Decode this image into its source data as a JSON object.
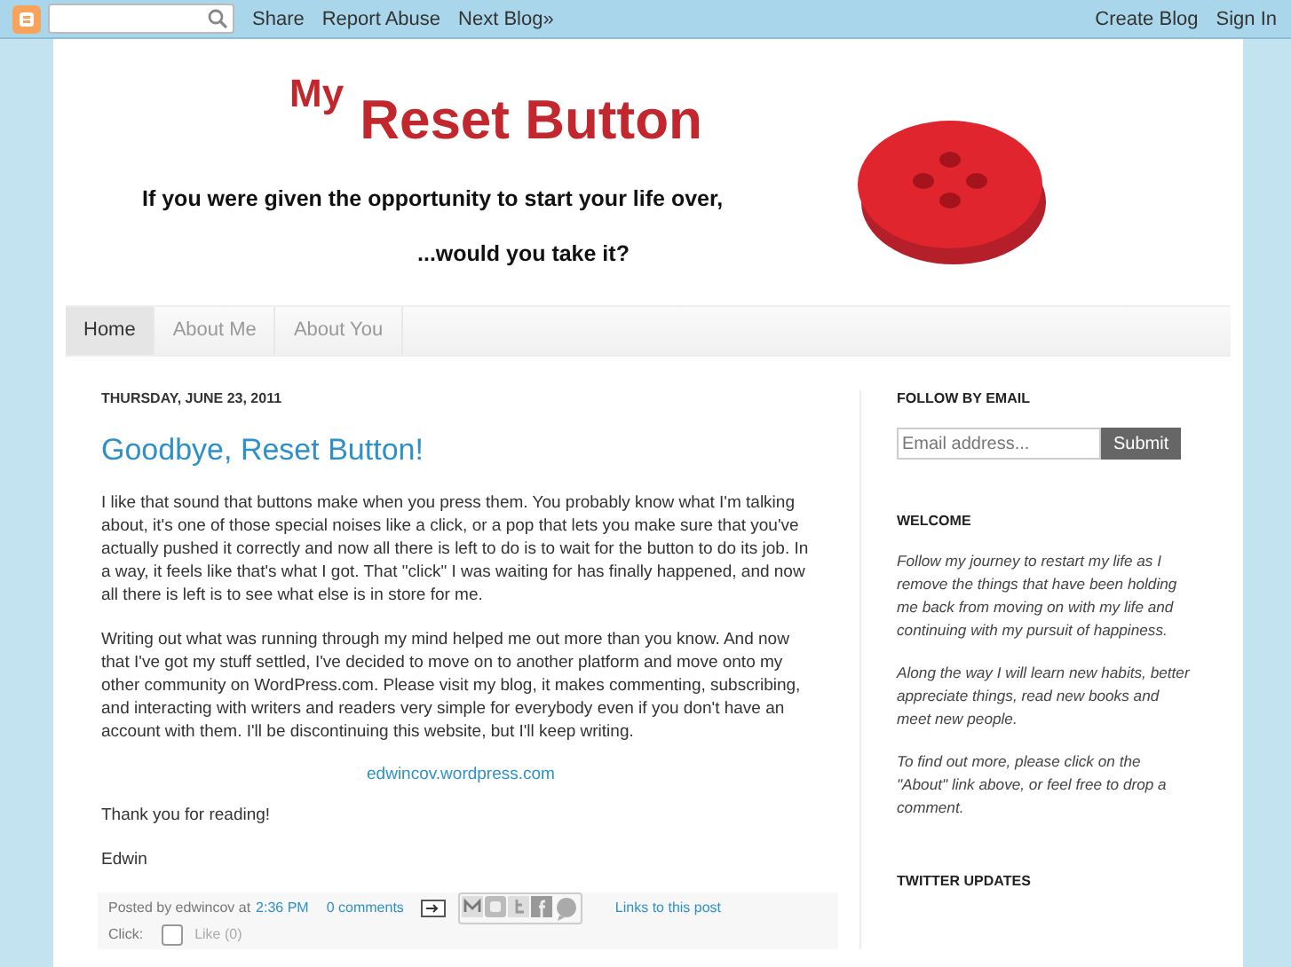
{
  "navbar": {
    "left_links": [
      "Share",
      "Report Abuse",
      "Next Blog»"
    ],
    "right_links": [
      "Create Blog",
      "Sign In"
    ]
  },
  "header": {
    "title_small": "My",
    "title_large": "Reset Button",
    "tagline_1": "If you were given the opportunity to start your life over,",
    "tagline_2": "...would you take it?"
  },
  "tabs": [
    {
      "label": "Home",
      "selected": true
    },
    {
      "label": "About Me",
      "selected": false
    },
    {
      "label": "About You",
      "selected": false
    }
  ],
  "post": {
    "date": "THURSDAY, JUNE 23, 2011",
    "title": "Goodbye, Reset Button!",
    "paragraphs": [
      "I like that sound that buttons make when you press them. You probably know what I'm talking about, it's one of those special noises like a click, or a pop that lets you make sure that you've actually pushed it correctly and now all there is left to do is to wait for the button to do its job. In a way, it feels like that's what I got. That \"click\" I was waiting for has finally happened, and now all there is left is to see what else is in store for me.",
      "Writing out what  was running through my mind helped me out more than you know. And now that I've got my stuff settled, I've decided to move on to another platform and move onto my other community on WordPress.com. Please visit my blog, it makes commenting, subscribing, and interacting with writers and readers very simple for everybody even if you don't have an account with them. I'll be discontinuing this website, but I'll keep writing."
    ],
    "link": "edwincov.wordpress.com",
    "closing": "Thank you for reading!",
    "signature": "Edwin",
    "footer": {
      "posted_by": "Posted by edwincov at",
      "time": "2:36 PM",
      "comments": "0 comments",
      "links": "Links to this post",
      "click_label": "Click:",
      "like": {
        "label": "Like (0)",
        "checked": false
      }
    }
  },
  "sidebar": {
    "follow_title": "FOLLOW BY EMAIL",
    "email_placeholder": "Email address...",
    "submit": "Submit",
    "welcome_title": "WELCOME",
    "welcome_paragraphs": [
      "Follow my journey to restart my life as I remove the things that have been holding me back from moving on with my life and continuing with my pursuit of happiness.",
      "Along the way I will learn new habits, better appreciate things, read new books and meet new people.",
      "To find out more, please click on the \"About\" link above, or feel free to drop a comment."
    ],
    "twitter_title": "TWITTER UPDATES"
  }
}
